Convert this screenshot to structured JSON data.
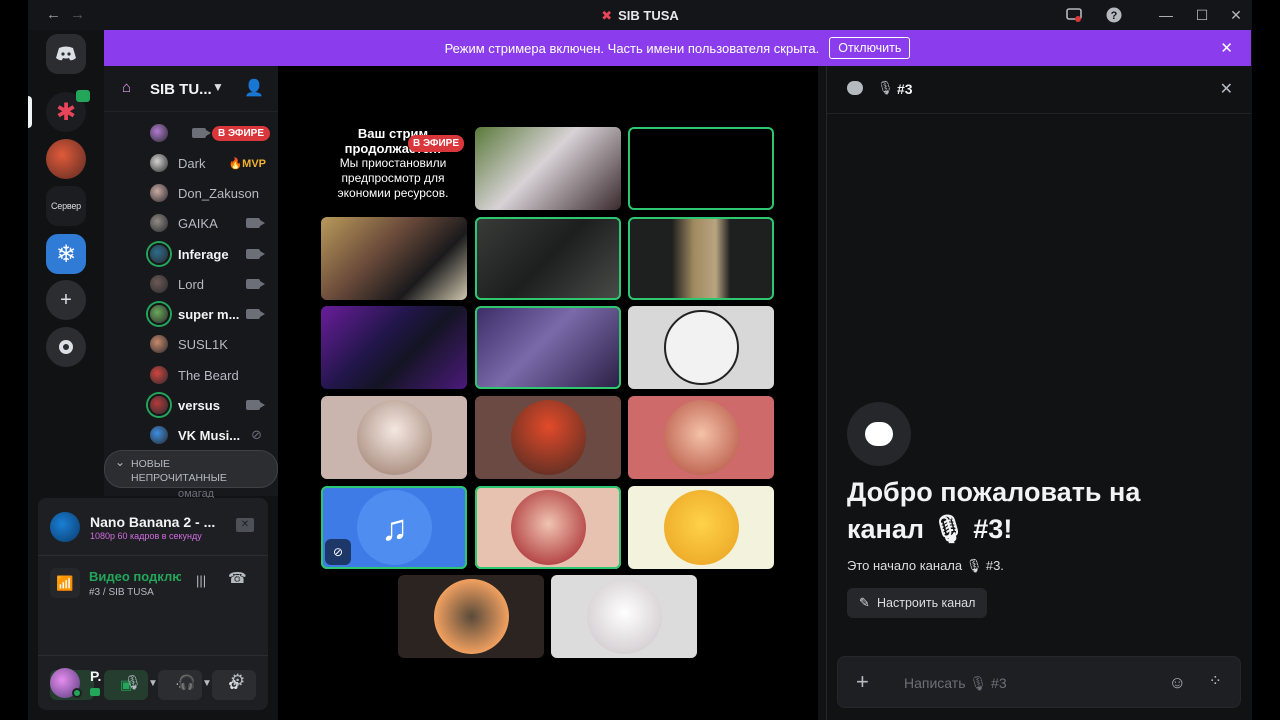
{
  "window": {
    "title": "SIB TUSA",
    "back": "←",
    "forward": "→"
  },
  "banner": {
    "text": "Режим стримера включен. Часть имени пользователя скрыта.",
    "button": "Отключить"
  },
  "rail": {
    "server_label": "Сервер"
  },
  "server": {
    "name": "SIB TU..."
  },
  "members": [
    {
      "name": "",
      "live_badge": "В ЭФИРЕ",
      "avatar_color": "#b07ad0"
    },
    {
      "name": "Dark",
      "badge": "🔥MVP",
      "avatar_color": "#d4d2cf"
    },
    {
      "name": "Don_Zakuson",
      "avatar_color": "#c9a9a2"
    },
    {
      "name": "GAIKA",
      "avatar_color": "#8f8a82"
    },
    {
      "name": "Inferage",
      "avatar_color": "#2d6d8c"
    },
    {
      "name": "Lord",
      "avatar_color": "#6b5a55"
    },
    {
      "name": "super m...",
      "avatar_color": "#6aa85a"
    },
    {
      "name": "SUSL1K",
      "avatar_color": "#c78a6b"
    },
    {
      "name": "The Beard",
      "avatar_color": "#d0453f"
    },
    {
      "name": "versus",
      "avatar_color": "#b33b3b"
    },
    {
      "name": "VK Musi...",
      "avatar_color": "#3d8ee0"
    }
  ],
  "unread": {
    "line1": "НОВЫЕ",
    "line2": "НЕПРОЧИТАННЫЕ",
    "peek": "омагад"
  },
  "voice_panel": {
    "stream_title": "Nano Banana 2 - ...",
    "stream_info": "1080p 60 кадров в секунду",
    "connection": "Видео подклю...",
    "channel": "#3 / SIB TUSA",
    "user": "P."
  },
  "stage": {
    "paused_title": "Ваш стрим продолжается!",
    "paused_live": "В ЭФИРЕ",
    "paused_text": "Мы приостановили предпросмотр для экономии ресурсов."
  },
  "chat": {
    "channel": "#3",
    "welcome_line1": "Добро пожаловать на",
    "welcome_line2": "канал 🎙 #3!",
    "start": "Это начало канала 🎙 #3.",
    "configure": "Настроить канал",
    "placeholder": "Написать 🎙 #3"
  },
  "colors": {
    "accent": "#8b3dee",
    "speaking": "#2dc770",
    "live": "#da373c",
    "connected": "#23a55a"
  }
}
